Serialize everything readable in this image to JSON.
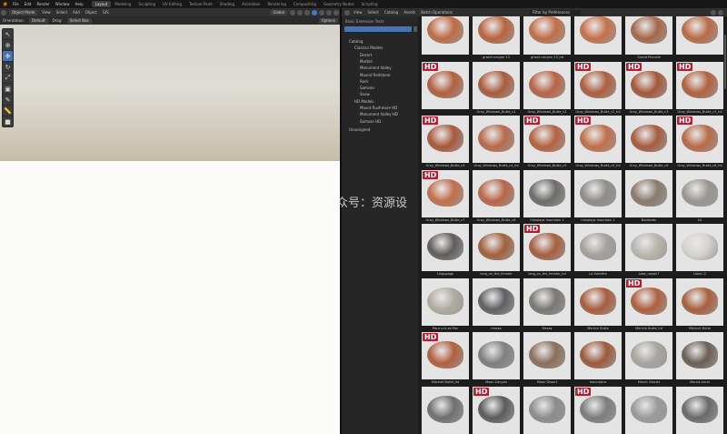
{
  "app": {
    "menus": [
      "File",
      "Edit",
      "Render",
      "Window",
      "Help"
    ],
    "workspaces": [
      "Layout",
      "Modeling",
      "Sculpting",
      "UV Editing",
      "Texture Paint",
      "Shading",
      "Animation",
      "Rendering",
      "Compositing",
      "Geometry Nodes",
      "Scripting"
    ],
    "active_workspace": "Layout"
  },
  "viewport": {
    "mode": "Object Mode",
    "menus": [
      "View",
      "Select",
      "Add",
      "Object",
      "GIS"
    ],
    "orientation_label": "Orientation:",
    "orientation": "Default",
    "drag_label": "Drag:",
    "drag": "Select Box",
    "shading": "Global",
    "options": "Options"
  },
  "asset_browser": {
    "menus": [
      "View",
      "Select",
      "Catalog",
      "Assets",
      "Batch Operations"
    ],
    "search_placeholder": "Filter by Preferences",
    "library": "Basic Extension Tests",
    "tree": [
      {
        "label": "Catalog",
        "level": 0
      },
      {
        "label": "Classics Models",
        "level": 1
      },
      {
        "label": "Desert",
        "level": 2
      },
      {
        "label": "Marble",
        "level": 2
      },
      {
        "label": "Monument Valley",
        "level": 2
      },
      {
        "label": "Mound Redstone",
        "level": 2
      },
      {
        "label": "Rock",
        "level": 2
      },
      {
        "label": "Samson",
        "level": 2
      },
      {
        "label": "Snow",
        "level": 2
      },
      {
        "label": "HD Models",
        "level": 1
      },
      {
        "label": "Mount Rushmore HD",
        "level": 2
      },
      {
        "label": "Monument Valley HD",
        "level": 2
      },
      {
        "label": "Samson HD",
        "level": 2
      },
      {
        "label": "Unassigned",
        "level": 0
      }
    ],
    "assets": [
      {
        "label": "",
        "hd": false,
        "color": "#c06a45"
      },
      {
        "label": "grand canyon 13",
        "hd": false,
        "color": "#b8643f"
      },
      {
        "label": "grand canyon 13_hd",
        "hd": false,
        "color": "#c26d48"
      },
      {
        "label": "",
        "hd": false,
        "color": "#c7704a"
      },
      {
        "label": "Grand Pinnaile",
        "hd": false,
        "color": "#a46749"
      },
      {
        "label": "",
        "hd": false,
        "color": "#b96a46"
      },
      {
        "label": "",
        "hd": true,
        "color": "#b2603d"
      },
      {
        "label": "Gray_Windows_Butte_c1",
        "hd": false,
        "color": "#a95c3c"
      },
      {
        "label": "Gray_Windows_Butte_c2",
        "hd": false,
        "color": "#b76443"
      },
      {
        "label": "Gray_Windows_Butte_c2_hd",
        "hd": true,
        "color": "#ad5e3e"
      },
      {
        "label": "Gray_Windows_Butte_c3",
        "hd": true,
        "color": "#a4573a"
      },
      {
        "label": "Gray_Windows_Butte_c3_hd",
        "hd": true,
        "color": "#b2603f"
      },
      {
        "label": "Gray_Windows_Butte_c4",
        "hd": true,
        "color": "#a8593b"
      },
      {
        "label": "Gray_Windows_Butte_c4_hd",
        "hd": false,
        "color": "#b9694a"
      },
      {
        "label": "Gray_Windows_Butte_c5",
        "hd": true,
        "color": "#b3633f"
      },
      {
        "label": "Gray_Windows_Butte_c5_hd",
        "hd": true,
        "color": "#c07049"
      },
      {
        "label": "Gray_Windows_Butte_c6",
        "hd": false,
        "color": "#a65c3e"
      },
      {
        "label": "Gray_Windows_Butte_c6_hd",
        "hd": true,
        "color": "#b86a47"
      },
      {
        "label": "Gray_Windows_Butte_c7",
        "hd": true,
        "color": "#c26e4a"
      },
      {
        "label": "Gray_Windows_Butte_c8",
        "hd": false,
        "color": "#b96547"
      },
      {
        "label": "himalaya mountain 1",
        "hd": false,
        "color": "#6d6c6a"
      },
      {
        "label": "himalaya mountain 2",
        "hd": false,
        "color": "#8f8d8a"
      },
      {
        "label": "Badlands",
        "hd": false,
        "color": "#8a7a6e"
      },
      {
        "label": "h2",
        "hd": false,
        "color": "#9a9791"
      },
      {
        "label": "Lingsgage",
        "hd": false,
        "color": "#5e5d5b"
      },
      {
        "label": "long_on_the_fenster",
        "hd": false,
        "color": "#a2603e"
      },
      {
        "label": "long_on_the_fenster_hd",
        "hd": true,
        "color": "#a65f3f"
      },
      {
        "label": "La Sorcière",
        "hd": false,
        "color": "#a5a29c"
      },
      {
        "label": "Lake_rowan7",
        "hd": false,
        "color": "#b9b6ae"
      },
      {
        "label": "Llanin 2",
        "hd": false,
        "color": "#d5d3ce"
      },
      {
        "label": "Ma.e.s.lu.ea Pan",
        "hd": false,
        "color": "#b1aca3"
      },
      {
        "label": "mesas",
        "hd": false,
        "color": "#5f6062"
      },
      {
        "label": "Mesas",
        "hd": false,
        "color": "#7a7874"
      },
      {
        "label": "Merrick Butte",
        "hd": false,
        "color": "#a75c3d"
      },
      {
        "label": "Merrick Butte_hd",
        "hd": true,
        "color": "#ae603f"
      },
      {
        "label": "Mitchell Butte",
        "hd": false,
        "color": "#a8603e"
      },
      {
        "label": "Mitchell Butte_hd",
        "hd": true,
        "color": "#b0603f"
      },
      {
        "label": "Moon Canyon",
        "hd": false,
        "color": "#7f7f80"
      },
      {
        "label": "Moon Desert",
        "hd": false,
        "color": "#8b6f5c"
      },
      {
        "label": "mountains",
        "hd": false,
        "color": "#9c5a3b"
      },
      {
        "label": "Mount Glacier",
        "hd": false,
        "color": "#a8a5a0"
      },
      {
        "label": "Mount cloud",
        "hd": false,
        "color": "#6a5e55"
      },
      {
        "label": "",
        "hd": false,
        "color": "#6f6f70"
      },
      {
        "label": "",
        "hd": true,
        "color": "#5b5b5c"
      },
      {
        "label": "",
        "hd": false,
        "color": "#8c8c8b"
      },
      {
        "label": "",
        "hd": true,
        "color": "#7d7d7c"
      },
      {
        "label": "",
        "hd": false,
        "color": "#9a9a99"
      },
      {
        "label": "",
        "hd": false,
        "color": "#6a6a6a"
      }
    ]
  },
  "watermark": "众号：资源设"
}
